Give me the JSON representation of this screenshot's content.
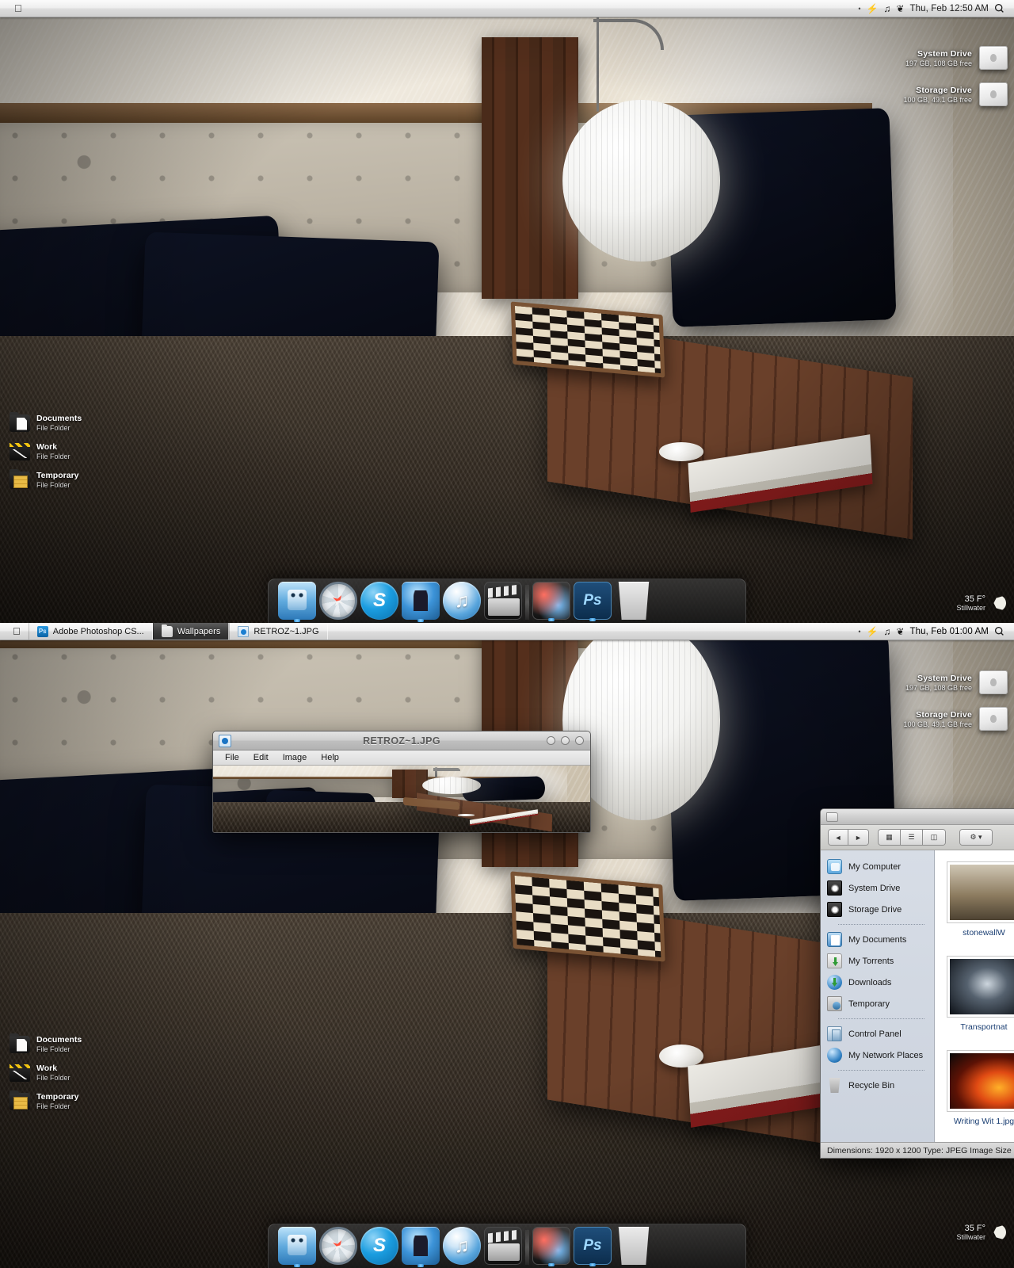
{
  "menubar_top": {
    "apple_logo": "apple-logo",
    "status_dot": "•",
    "icons": [
      "bolt-icon",
      "music-note-icon",
      "bug-icon"
    ],
    "bolt_glyph": "⚡",
    "music_glyph": "♫",
    "bug_glyph": "❦",
    "clock": "Thu, Feb 12:50 AM",
    "spotlight": "spotlight-icon"
  },
  "menubar_bottom": {
    "clock": "Thu, Feb 01:00 AM"
  },
  "taskbar": {
    "items": [
      {
        "label": "Adobe Photoshop CS...",
        "icon": "photoshop-icon",
        "active": false
      },
      {
        "label": "Wallpapers",
        "icon": "folder-icon",
        "active": true
      },
      {
        "label": "RETROZ~1.JPG",
        "icon": "image-file-icon",
        "active": false
      }
    ]
  },
  "drives": [
    {
      "name": "System Drive",
      "info": "197 GB, 108 GB free"
    },
    {
      "name": "Storage Drive",
      "info": "100 GB, 49.1 GB free"
    }
  ],
  "desktop_icons": [
    {
      "name": "Documents",
      "type": "File Folder",
      "glyph": "documents-folder-icon"
    },
    {
      "name": "Work",
      "type": "File Folder",
      "glyph": "work-folder-icon"
    },
    {
      "name": "Temporary",
      "type": "File Folder",
      "glyph": "temporary-folder-icon"
    }
  ],
  "weather": {
    "temp": "35 F°",
    "location": "Stillwater",
    "condition": "moon-icon"
  },
  "dock": {
    "items": [
      {
        "name": "finder",
        "running": true
      },
      {
        "name": "safari",
        "running": false
      },
      {
        "name": "skype",
        "running": false
      },
      {
        "name": "address-book",
        "running": true
      },
      {
        "name": "itunes",
        "running": false
      },
      {
        "name": "quicktime",
        "running": false
      },
      {
        "name": "separator",
        "running": false
      },
      {
        "name": "image-editor",
        "running": true
      },
      {
        "name": "photoshop",
        "running": true
      },
      {
        "name": "trash",
        "running": false
      }
    ]
  },
  "viewer_window": {
    "title": "RETROZ~1.JPG",
    "icon": "image-viewer-icon",
    "menus": [
      "File",
      "Edit",
      "Image",
      "Help"
    ],
    "controls": [
      "minimize",
      "maximize",
      "close"
    ]
  },
  "explorer_window": {
    "title_icon": "folder-icon",
    "nav_back": "◄",
    "nav_forward": "►",
    "view_buttons": [
      "icon-view",
      "list-view",
      "column-view"
    ],
    "action_button": "action-dropdown",
    "sidebar": [
      {
        "label": "My Computer",
        "icon": "computer-icon",
        "sep_after": false
      },
      {
        "label": "System Drive",
        "icon": "hard-drive-icon",
        "sep_after": false
      },
      {
        "label": "Storage Drive",
        "icon": "hard-drive-icon",
        "sep_after": true
      },
      {
        "label": "My Documents",
        "icon": "documents-icon",
        "sep_after": false
      },
      {
        "label": "My Torrents",
        "icon": "torrents-icon",
        "sep_after": false
      },
      {
        "label": "Downloads",
        "icon": "downloads-icon",
        "sep_after": false
      },
      {
        "label": "Temporary",
        "icon": "temporary-icon",
        "sep_after": true
      },
      {
        "label": "Control Panel",
        "icon": "control-panel-icon",
        "sep_after": false
      },
      {
        "label": "My Network Places",
        "icon": "network-icon",
        "sep_after": true
      },
      {
        "label": "Recycle Bin",
        "icon": "recycle-bin-icon",
        "sep_after": false
      }
    ],
    "files": [
      {
        "name": "stonewallW",
        "thumb": "ft-stonewall"
      },
      {
        "name": "Transportnat",
        "thumb": "ft-transport"
      },
      {
        "name": "Writing Wit 1.jpg",
        "thumb": "ft-writing"
      }
    ],
    "status": "Dimensions: 1920 x 1200 Type: JPEG Image Size"
  }
}
